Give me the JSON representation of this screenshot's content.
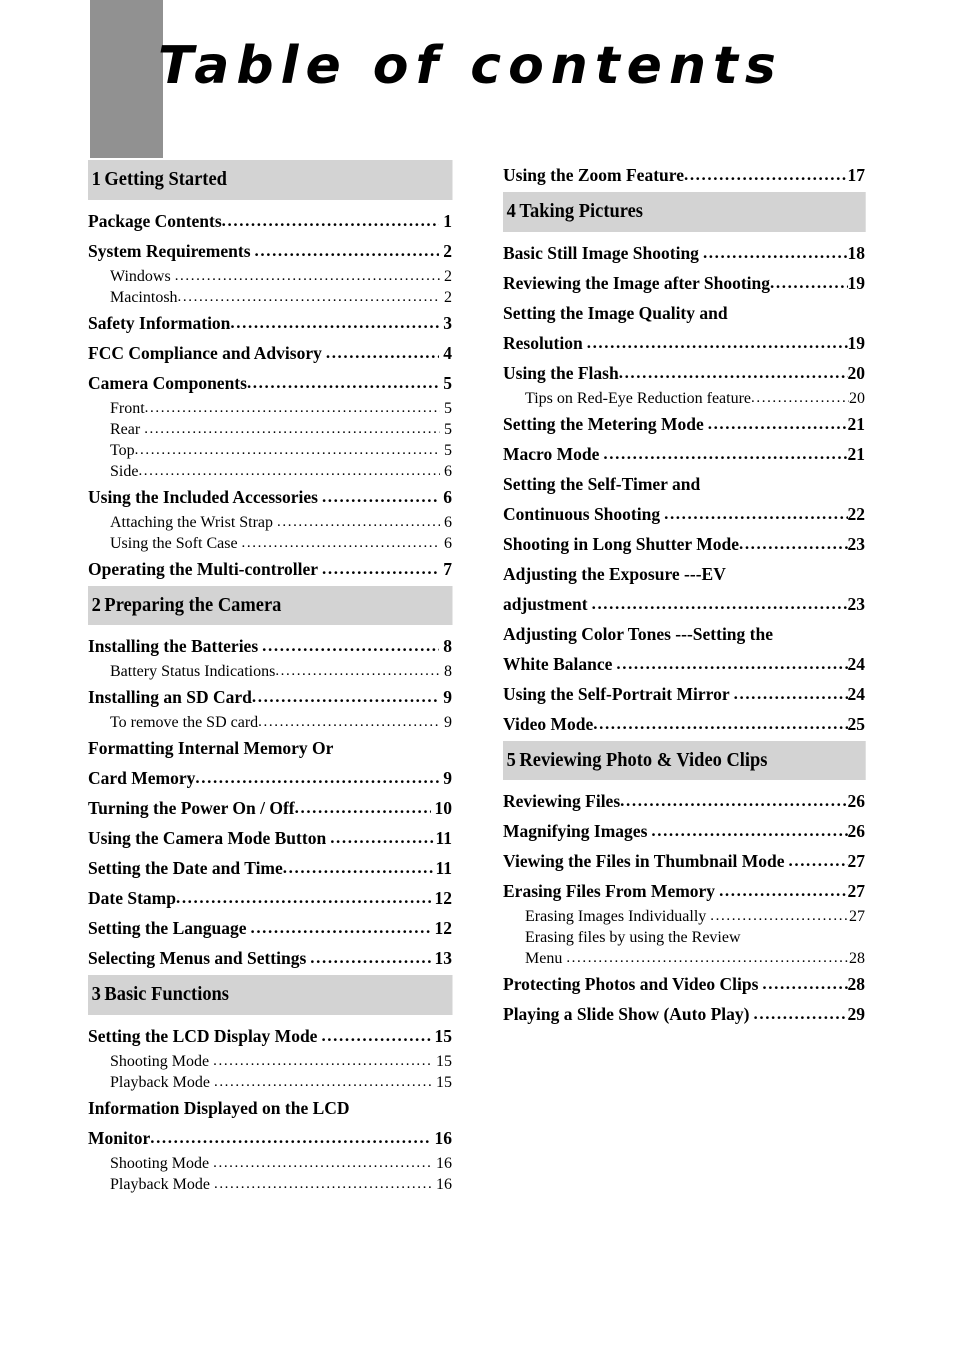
{
  "page": {
    "title": "Table of contents",
    "side_block_color": "#919191",
    "section_bar_color": "#d3d3d3"
  },
  "left_column": [
    {
      "kind": "section",
      "num": "1",
      "title": "Getting Started"
    },
    {
      "kind": "entry",
      "level": 1,
      "label": "Package Contents",
      "page": "1",
      "space_before_leader": false,
      "space_before_page": true
    },
    {
      "kind": "entry",
      "level": 1,
      "label": "System Requirements",
      "page": "2",
      "space_before_leader": true,
      "space_before_page": true
    },
    {
      "kind": "entry",
      "level": 2,
      "label": "Windows",
      "page": "2",
      "space_before_leader": true,
      "space_before_page": true
    },
    {
      "kind": "entry",
      "level": 2,
      "label": "Macintosh",
      "page": "2",
      "space_before_leader": false,
      "space_before_page": true
    },
    {
      "kind": "entry",
      "level": 1,
      "label": "Safety Information",
      "page": "3",
      "space_before_leader": false,
      "space_before_page": true
    },
    {
      "kind": "entry",
      "level": 1,
      "label": "FCC Compliance and Advisory",
      "page": "4",
      "space_before_leader": true,
      "space_before_page": true
    },
    {
      "kind": "entry",
      "level": 1,
      "label": "Camera Components",
      "page": "5",
      "space_before_leader": false,
      "space_before_page": true
    },
    {
      "kind": "entry",
      "level": 2,
      "label": "Front",
      "page": "5",
      "space_before_leader": false,
      "space_before_page": true
    },
    {
      "kind": "entry",
      "level": 2,
      "label": "Rear",
      "page": "5",
      "space_before_leader": true,
      "space_before_page": true
    },
    {
      "kind": "entry",
      "level": 2,
      "label": "Top",
      "page": "5",
      "space_before_leader": false,
      "space_before_page": true
    },
    {
      "kind": "entry",
      "level": 2,
      "label": "Side",
      "page": "6",
      "space_before_leader": false,
      "space_before_page": true
    },
    {
      "kind": "entry",
      "level": 1,
      "label": "Using the Included Accessories",
      "page": "6",
      "space_before_leader": true,
      "space_before_page": true
    },
    {
      "kind": "entry",
      "level": 2,
      "label": "Attaching the Wrist Strap",
      "page": "6",
      "space_before_leader": true,
      "space_before_page": true
    },
    {
      "kind": "entry",
      "level": 2,
      "label": "Using the Soft Case",
      "page": "6",
      "space_before_leader": true,
      "space_before_page": true
    },
    {
      "kind": "entry",
      "level": 1,
      "label": "Operating the Multi-controller",
      "page": "7",
      "space_before_leader": true,
      "space_before_page": true
    },
    {
      "kind": "section",
      "num": "2",
      "title": "Preparing the Camera"
    },
    {
      "kind": "entry",
      "level": 1,
      "label": "Installing the Batteries",
      "page": "8",
      "space_before_leader": true,
      "space_before_page": true
    },
    {
      "kind": "entry",
      "level": 2,
      "label": "Battery Status Indications",
      "page": "8",
      "space_before_leader": false,
      "space_before_page": true
    },
    {
      "kind": "entry",
      "level": 1,
      "label": "Installing an SD Card",
      "page": "9",
      "space_before_leader": false,
      "space_before_page": true
    },
    {
      "kind": "entry",
      "level": 2,
      "label": "To remove the SD card",
      "page": "9",
      "space_before_leader": false,
      "space_before_page": true
    },
    {
      "kind": "entry",
      "level": 1,
      "label": "Formatting Internal Memory Or",
      "page": "",
      "no_leader": true
    },
    {
      "kind": "entry",
      "level": 1,
      "label": "Card Memory",
      "page": "9",
      "space_before_leader": false,
      "space_before_page": true
    },
    {
      "kind": "entry",
      "level": 1,
      "label": "Turning the Power On / Off",
      "page": "10",
      "space_before_leader": false,
      "space_before_page": true
    },
    {
      "kind": "entry",
      "level": 1,
      "label": "Using the Camera Mode Button",
      "page": "11",
      "space_before_leader": true,
      "space_before_page": false
    },
    {
      "kind": "entry",
      "level": 1,
      "label": "Setting the Date and Time",
      "page": "11",
      "space_before_leader": false,
      "space_before_page": false
    },
    {
      "kind": "entry",
      "level": 1,
      "label": "Date Stamp",
      "page": "12",
      "space_before_leader": false,
      "space_before_page": true
    },
    {
      "kind": "entry",
      "level": 1,
      "label": "Setting the Language",
      "page": "12",
      "space_before_leader": true,
      "space_before_page": true
    },
    {
      "kind": "entry",
      "level": 1,
      "label": "Selecting Menus and Settings",
      "page": "13",
      "space_before_leader": true,
      "space_before_page": true
    },
    {
      "kind": "section",
      "num": "3",
      "title": "Basic Functions"
    },
    {
      "kind": "entry",
      "level": 1,
      "label": "Setting the LCD Display Mode",
      "page": "15",
      "space_before_leader": true,
      "space_before_page": true
    },
    {
      "kind": "entry",
      "level": 2,
      "label": "Shooting Mode",
      "page": "15",
      "space_before_leader": true,
      "space_before_page": true
    },
    {
      "kind": "entry",
      "level": 2,
      "label": "Playback Mode",
      "page": "15",
      "space_before_leader": true,
      "space_before_page": true
    },
    {
      "kind": "entry",
      "level": 1,
      "label": "Information Displayed on the LCD",
      "page": "",
      "no_leader": true
    },
    {
      "kind": "entry",
      "level": 1,
      "label": "Monitor",
      "page": "16",
      "space_before_leader": false,
      "space_before_page": true
    },
    {
      "kind": "entry",
      "level": 2,
      "label": "Shooting Mode",
      "page": "16",
      "space_before_leader": true,
      "space_before_page": true
    },
    {
      "kind": "entry",
      "level": 2,
      "label": "Playback Mode",
      "page": "16",
      "space_before_leader": true,
      "space_before_page": true
    }
  ],
  "right_column": [
    {
      "kind": "entry",
      "level": 1,
      "label": "Using the Zoom Feature",
      "page": "17",
      "space_before_leader": false,
      "space_before_page": false
    },
    {
      "kind": "section",
      "num": "4",
      "title": "Taking Pictures"
    },
    {
      "kind": "entry",
      "level": 1,
      "label": "Basic Still Image Shooting",
      "page": "18",
      "space_before_leader": true,
      "space_before_page": false
    },
    {
      "kind": "entry",
      "level": 1,
      "label": "Reviewing the Image after Shooting",
      "page": "19",
      "space_before_leader": false,
      "space_before_page": false
    },
    {
      "kind": "entry",
      "level": 1,
      "label": "Setting the Image Quality and",
      "page": "",
      "no_leader": true
    },
    {
      "kind": "entry",
      "level": 1,
      "label": "Resolution",
      "page": "19",
      "space_before_leader": true,
      "space_before_page": false
    },
    {
      "kind": "entry",
      "level": 1,
      "label": "Using the Flash",
      "page": "20",
      "space_before_leader": false,
      "space_before_page": false
    },
    {
      "kind": "entry",
      "level": 2,
      "label": "Tips on Red-Eye Reduction feature",
      "page": "20",
      "space_before_leader": false,
      "space_before_page": false
    },
    {
      "kind": "entry",
      "level": 1,
      "label": "Setting the Metering Mode",
      "page": "21",
      "space_before_leader": true,
      "space_before_page": false
    },
    {
      "kind": "entry",
      "level": 1,
      "label": "Macro Mode",
      "page": "21",
      "space_before_leader": true,
      "space_before_page": false
    },
    {
      "kind": "entry",
      "level": 1,
      "label": "Setting the Self-Timer and",
      "page": "",
      "no_leader": true
    },
    {
      "kind": "entry",
      "level": 1,
      "label": "Continuous Shooting",
      "page": "22",
      "space_before_leader": true,
      "space_before_page": false
    },
    {
      "kind": "entry",
      "level": 1,
      "label": "Shooting in Long Shutter Mode",
      "page": "23",
      "space_before_leader": false,
      "space_before_page": false
    },
    {
      "kind": "entry",
      "level": 1,
      "label": "Adjusting the Exposure ---EV",
      "page": "",
      "no_leader": true
    },
    {
      "kind": "entry",
      "level": 1,
      "label": "adjustment",
      "page": "23",
      "space_before_leader": true,
      "space_before_page": false
    },
    {
      "kind": "entry",
      "level": 1,
      "label": "Adjusting Color Tones ---Setting the",
      "page": "",
      "no_leader": true
    },
    {
      "kind": "entry",
      "level": 1,
      "label": "White Balance",
      "page": "24",
      "space_before_leader": true,
      "space_before_page": false
    },
    {
      "kind": "entry",
      "level": 1,
      "label": "Using the Self-Portrait Mirror",
      "page": "24",
      "space_before_leader": true,
      "space_before_page": false
    },
    {
      "kind": "entry",
      "level": 1,
      "label": "Video Mode",
      "page": "25",
      "space_before_leader": false,
      "space_before_page": false
    },
    {
      "kind": "section",
      "num": "5",
      "title": "Reviewing Photo & Video Clips"
    },
    {
      "kind": "entry",
      "level": 1,
      "label": "Reviewing Files",
      "page": "26",
      "space_before_leader": false,
      "space_before_page": false
    },
    {
      "kind": "entry",
      "level": 1,
      "label": "Magnifying Images",
      "page": "26",
      "space_before_leader": true,
      "space_before_page": false
    },
    {
      "kind": "entry",
      "level": 1,
      "label": "Viewing the Files in Thumbnail Mode",
      "page": "27",
      "space_before_leader": true,
      "space_before_page": false
    },
    {
      "kind": "entry",
      "level": 1,
      "label": "Erasing Files From Memory",
      "page": "27",
      "space_before_leader": true,
      "space_before_page": false
    },
    {
      "kind": "entry",
      "level": 2,
      "label": "Erasing Images Individually",
      "page": "27",
      "space_before_leader": true,
      "space_before_page": false
    },
    {
      "kind": "entry",
      "level": 2,
      "label": "Erasing files by using the Review",
      "page": "",
      "no_leader": true
    },
    {
      "kind": "entry",
      "level": 2,
      "label": "Menu",
      "page": "28",
      "space_before_leader": true,
      "space_before_page": false
    },
    {
      "kind": "entry",
      "level": 1,
      "label": "Protecting Photos and Video Clips",
      "page": "28",
      "space_before_leader": true,
      "space_before_page": false
    },
    {
      "kind": "entry",
      "level": 1,
      "label": "Playing a Slide Show (Auto Play)",
      "page": "29",
      "space_before_leader": true,
      "space_before_page": false
    }
  ]
}
